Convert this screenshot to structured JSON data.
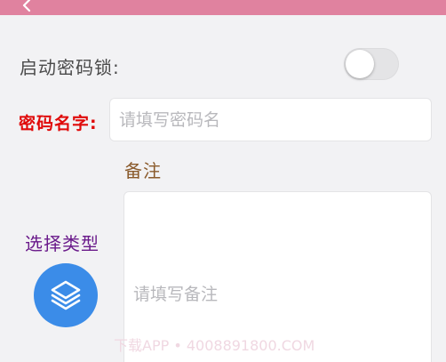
{
  "lock": {
    "label": "启动密码锁:",
    "enabled": false
  },
  "password_name": {
    "label": "密码名字:",
    "placeholder": "请填写密码名",
    "value": ""
  },
  "note": {
    "label": "备注",
    "placeholder": "请填写备注",
    "value": ""
  },
  "type": {
    "label": "选择类型",
    "icon": "layers-icon"
  },
  "watermark": {
    "text": "下载APP • 4008891800.COM"
  },
  "colors": {
    "header": "#e0829f",
    "name_label": "#e00a0a",
    "note_label": "#8a5a2b",
    "type_label": "#6a1a8a",
    "type_button": "#3b8ce8"
  }
}
